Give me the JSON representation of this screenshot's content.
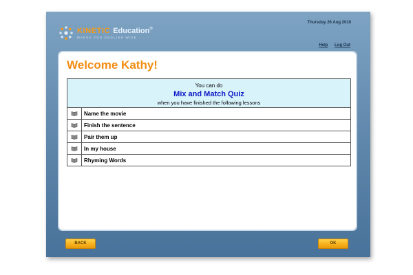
{
  "brand": {
    "name": "KINETIC",
    "product": "Education",
    "reg_mark": "®",
    "tagline": "MAKES YOU ENGLISH WISE"
  },
  "header": {
    "date": "Thursday 26 Aug 2010",
    "help_label": "Help",
    "logout_label": "Log Out"
  },
  "main": {
    "welcome": "Welcome Kathy!",
    "quiz_intro": "You can do",
    "quiz_name": "Mix and Match Quiz",
    "quiz_condition": "when you have finished the following lessons",
    "lessons": [
      {
        "label": "Name the movie",
        "icon": "book-icon"
      },
      {
        "label": "Finish the sentence",
        "icon": "book-icon"
      },
      {
        "label": "Pair them up",
        "icon": "book-icon"
      },
      {
        "label": "In my house",
        "icon": "book-icon"
      },
      {
        "label": "Rhyming Words",
        "icon": "book-icon"
      }
    ]
  },
  "footer": {
    "back_label": "BACK",
    "ok_label": "OK"
  },
  "colors": {
    "accent_orange": "#f28c12",
    "quiz_blue": "#0b18c6",
    "header_cell_bg": "#d9f3fb",
    "button_yellow": "#f7b01c",
    "window_blue": "#5e86aa"
  }
}
